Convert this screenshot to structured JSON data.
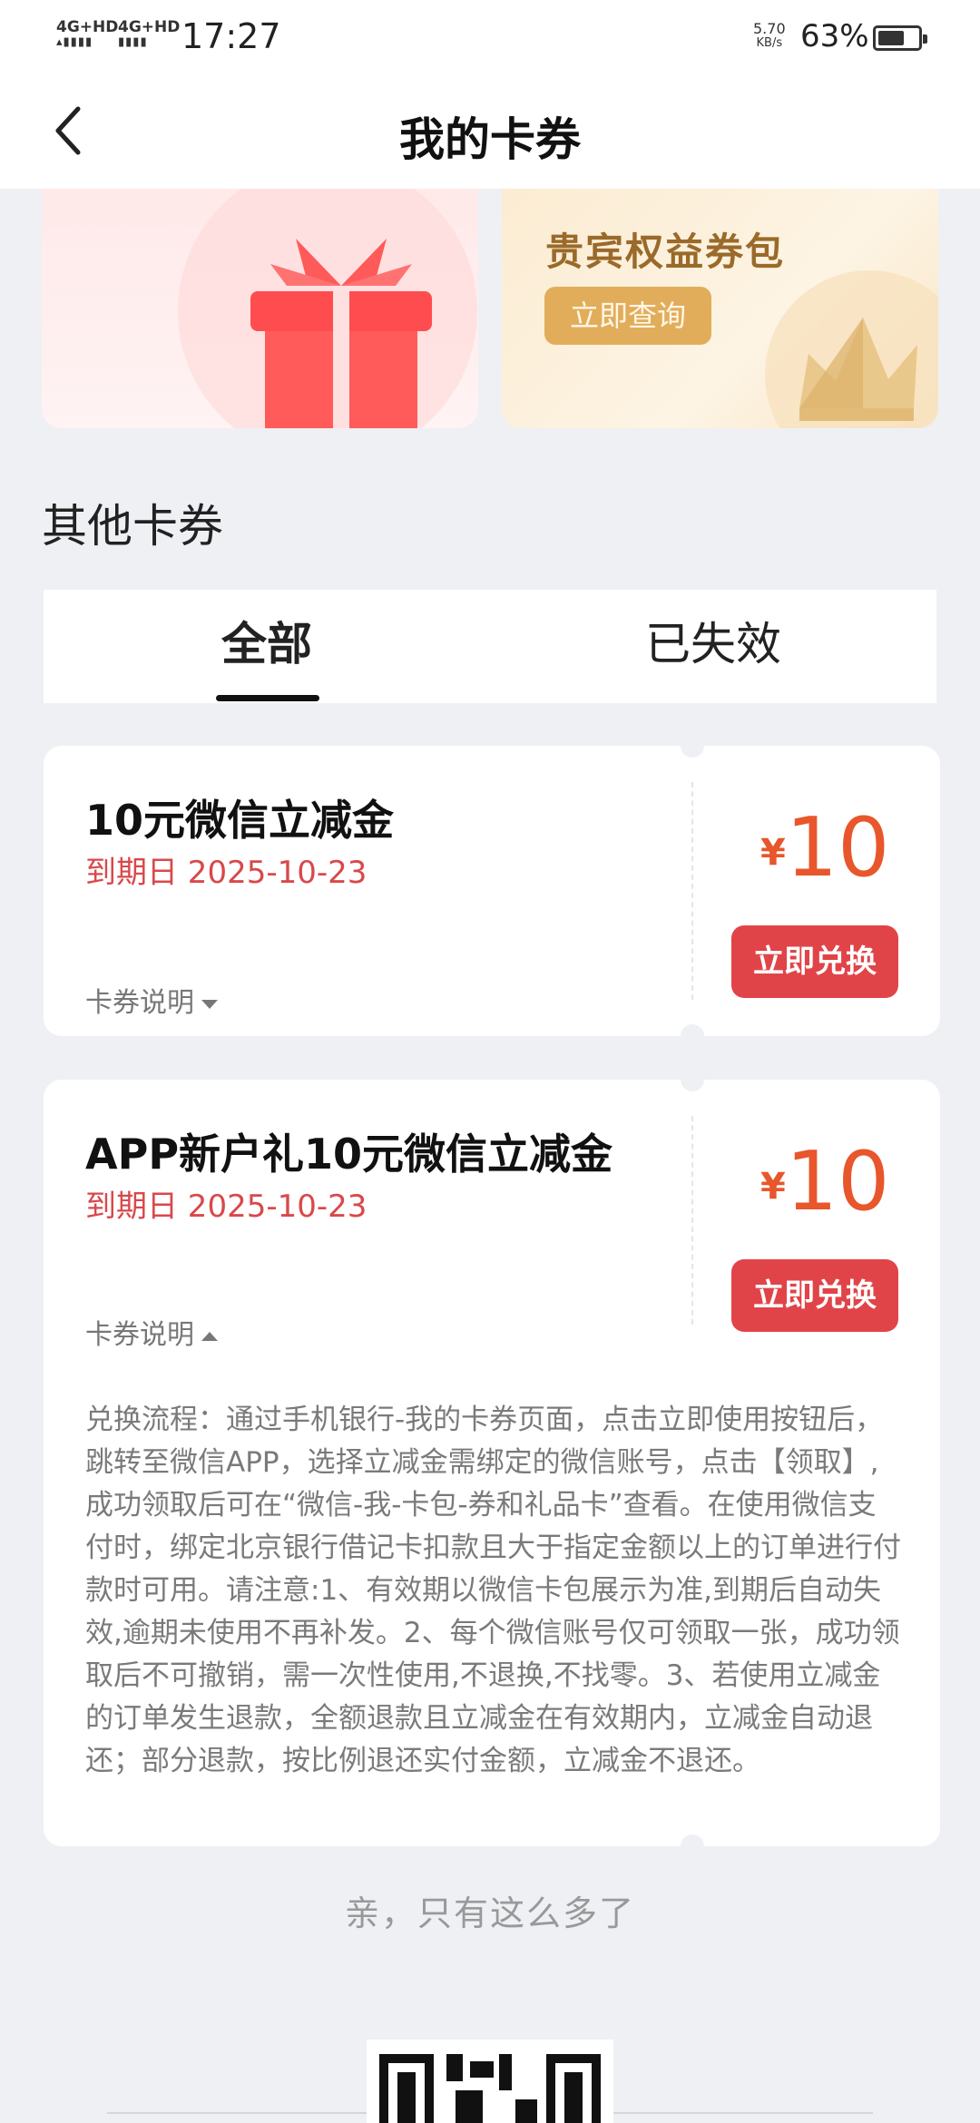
{
  "status_bar": {
    "network1": "4G+HD",
    "network2": "4G+HD",
    "time": "17:27",
    "speed_value": "5.70",
    "speed_unit": "KB/s",
    "battery_percent": "63%",
    "battery_level": 0.63
  },
  "nav": {
    "back_icon": "chevron-left-icon",
    "title": "我的卡券"
  },
  "banners": {
    "gift_icon": "gift-box-icon",
    "vip": {
      "title": "贵宾权益券包",
      "button": "立即查询",
      "icon": "crown-icon"
    }
  },
  "section_title": "其他卡券",
  "tabs": [
    {
      "label": "全部",
      "active": true
    },
    {
      "label": "已失效",
      "active": false
    }
  ],
  "coupons": [
    {
      "title": "10元微信立减金",
      "expiry": "到期日 2025-10-23",
      "note_label": "卡券说明",
      "currency": "¥",
      "amount": "10",
      "button": "立即兑换",
      "expanded": false
    },
    {
      "title": "APP新户礼10元微信立减金",
      "expiry": "到期日 2025-10-23",
      "note_label": "卡券说明",
      "currency": "¥",
      "amount": "10",
      "button": "立即兑换",
      "expanded": true,
      "description": "兑换流程：通过手机银行-我的卡券页面，点击立即使用按钮后，跳转至微信APP，选择立减金需绑定的微信账号，点击【领取】,成功领取后可在“微信-我-卡包-券和礼品卡”查看。在使用微信支付时，绑定北京银行借记卡扣款且大于指定金额以上的订单进行付款时可用。请注意:1、有效期以微信卡包展示为准,到期后自动失效,逾期未使用不再补发。2、每个微信账号仅可领取一张，成功领取后不可撤销，需一次性使用,不退换,不找零。3、若使用立减金的订单发生退款，全额退款且立减金在有效期内，立减金自动退还；部分退款，按比例退还实付金额，立减金不退还。"
    }
  ],
  "end_note": "亲，只有这么多了",
  "colors": {
    "accent_red": "#e14448",
    "price_orange": "#e8562b",
    "expiry_red": "#d9484b",
    "vip_gold": "#e2ad5b"
  }
}
